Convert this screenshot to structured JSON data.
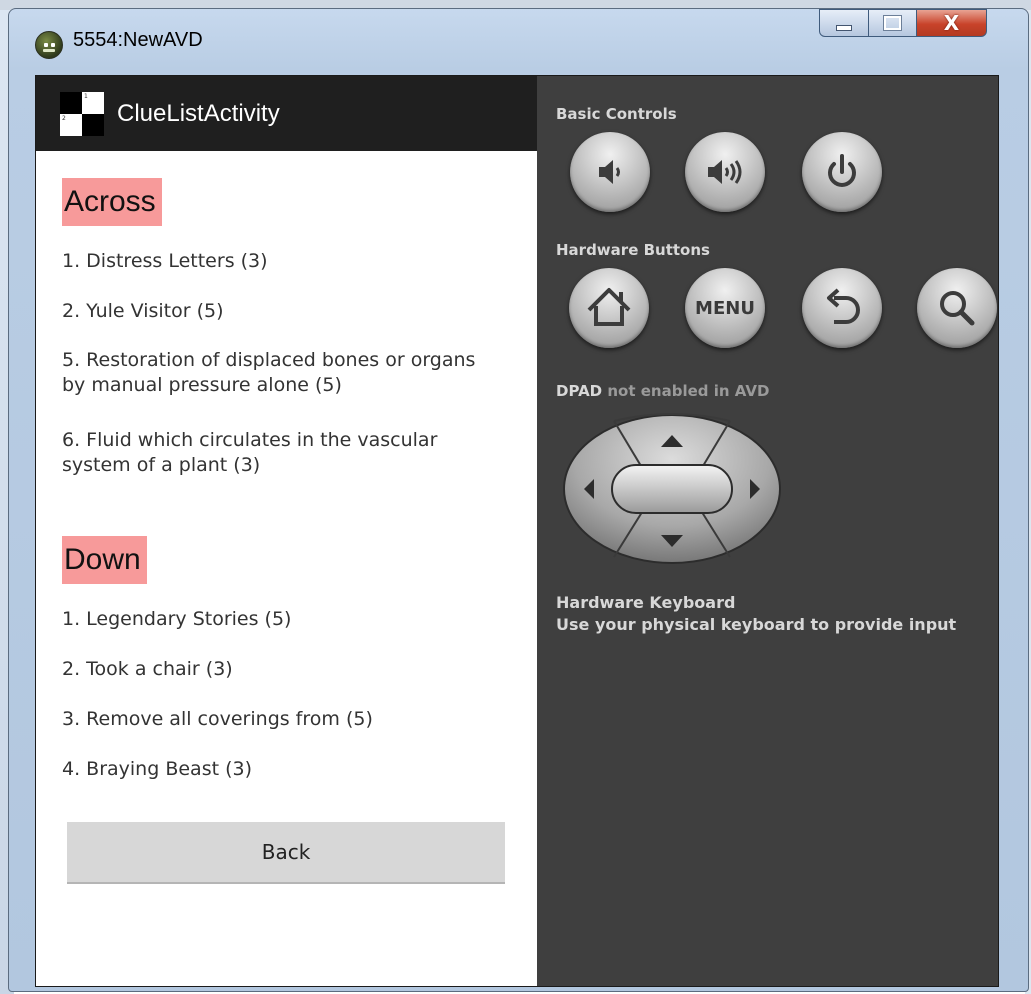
{
  "window": {
    "title": "5554:NewAVD",
    "close_glyph": "X"
  },
  "app": {
    "activity_title": "ClueListActivity"
  },
  "across": {
    "heading": "Across",
    "clues": [
      "1. Distress Letters (3)",
      "2. Yule Visitor (5)",
      "5. Restoration of displaced bones or organs by manual pressure alone (5)",
      "6. Fluid which circulates in the vascular system of a plant (3)"
    ]
  },
  "down": {
    "heading": "Down",
    "clues": [
      "1. Legendary Stories (5)",
      "2. Took a chair (3)",
      "3. Remove all coverings from (5)",
      "4. Braying Beast (3)"
    ]
  },
  "back_button": {
    "label": "Back"
  },
  "controls": {
    "basic_heading": "Basic Controls",
    "hardware_heading": "Hardware Buttons",
    "menu_label": "MENU",
    "dpad_prefix": "DPAD",
    "dpad_suffix": " not enabled in AVD",
    "keyboard_title": "Hardware Keyboard",
    "keyboard_desc": "Use your physical keyboard to provide input"
  },
  "colors": {
    "heading_highlight": "#f79a9a",
    "action_bar": "#1f1f1f",
    "controls_panel": "#3f3f3f"
  }
}
